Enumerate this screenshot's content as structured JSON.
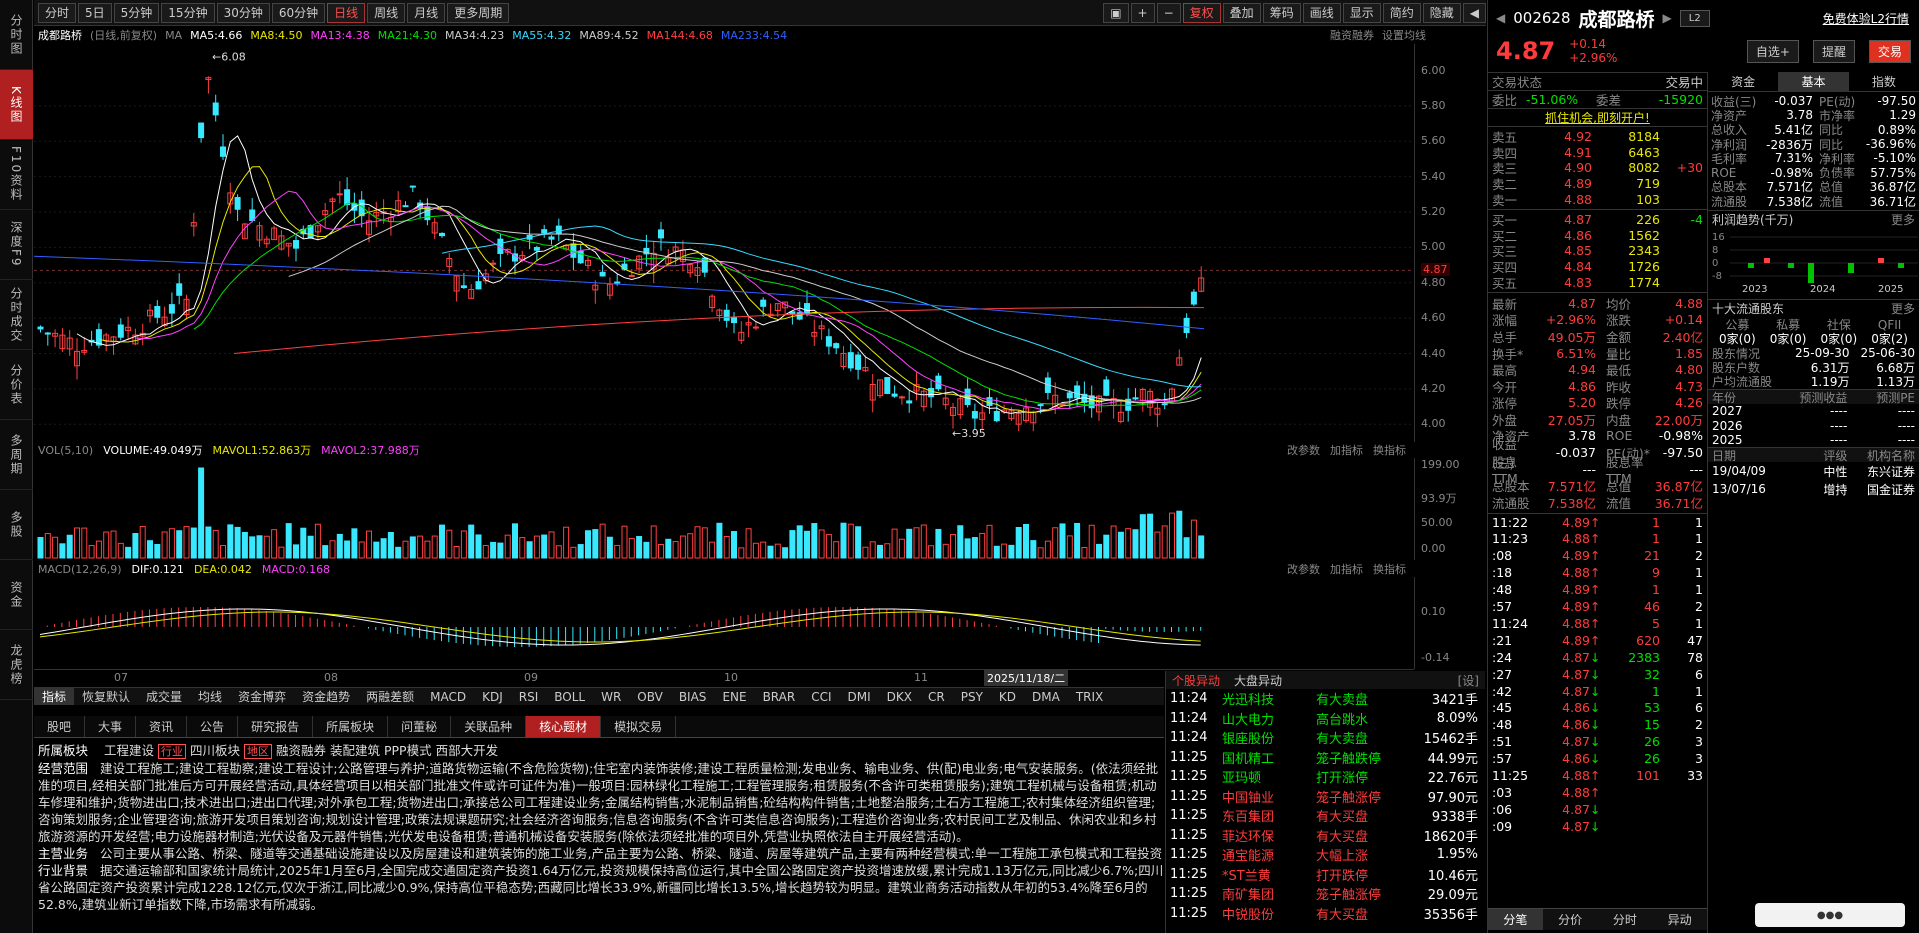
{
  "left_nav": [
    "分时图",
    "K线图",
    "F10资料",
    "深度F9",
    "分时成交",
    "分价表",
    "多周期",
    "多股",
    "资金",
    "龙虎榜"
  ],
  "toolbar": {
    "periods": [
      "分时",
      "5日",
      "5分钟",
      "15分钟",
      "30分钟",
      "60分钟",
      "日线",
      "周线",
      "月线",
      "更多周期"
    ],
    "active": "日线",
    "tools": [
      "复权",
      "叠加",
      "筹码",
      "画线",
      "显示",
      "简约",
      "隐藏"
    ]
  },
  "chart_head": {
    "name": "成都路桥",
    "mode": "(日线,前复权)",
    "ma_label": "MA",
    "ma": [
      {
        "t": "MA5:4.66",
        "c": "#ffffff"
      },
      {
        "t": "MA8:4.50",
        "c": "#e8e800"
      },
      {
        "t": "MA13:4.38",
        "c": "#ff40ff"
      },
      {
        "t": "MA21:4.30",
        "c": "#00e000"
      },
      {
        "t": "MA34:4.23",
        "c": "#cccccc"
      },
      {
        "t": "MA55:4.32",
        "c": "#38d8ff"
      },
      {
        "t": "MA89:4.52",
        "c": "#cccccc"
      },
      {
        "t": "MA144:4.68",
        "c": "#ff4040"
      },
      {
        "t": "MA233:4.54",
        "c": "#3060ff"
      }
    ],
    "right": [
      "融资融券",
      "设置均线"
    ]
  },
  "price_axis": [
    "6.00",
    "5.80",
    "5.60",
    "5.40",
    "5.20",
    "5.00",
    "4.87",
    "4.80",
    "4.60",
    "4.40",
    "4.20",
    "4.00"
  ],
  "annot": {
    "high": "6.08",
    "low": "3.95"
  },
  "vol_head": {
    "label": "VOL(5,10)",
    "volume": "VOLUME:49.049万",
    "mavol1": "MAVOL1:52.863万",
    "mavol2": "MAVOL2:37.988万",
    "tools": [
      "改参数",
      "加指标",
      "换指标"
    ]
  },
  "vol_axis": [
    "199.00",
    "93.9万",
    "50.00",
    "0.00"
  ],
  "macd_head": {
    "label": "MACD(12,26,9)",
    "dif": "DIF:0.121",
    "dea": "DEA:0.042",
    "macd": "MACD:0.168",
    "tools": [
      "改参数",
      "加指标",
      "换指标"
    ]
  },
  "macd_axis": [
    "0.10",
    "-0.14"
  ],
  "date_axis": [
    "07",
    "08",
    "09",
    "10",
    "11"
  ],
  "date_cursor": "2025/11/18/二",
  "indicator_tabs": [
    "指标",
    "恢复默认",
    "成交量",
    "均线",
    "资金博弈",
    "资金趋势",
    "两融差额",
    "MACD",
    "KDJ",
    "RSI",
    "BOLL",
    "WR",
    "OBV",
    "BIAS",
    "ENE",
    "BRAR",
    "CCI",
    "DMI",
    "DKX",
    "CR",
    "PSY",
    "KD",
    "DMA",
    "TRIX"
  ],
  "info_tabs": [
    "股吧",
    "大事",
    "资讯",
    "公告",
    "研究报告",
    "所属板块",
    "问董秘",
    "关联品种",
    "核心题材",
    "模拟交易"
  ],
  "info_active": "核心题材",
  "info": {
    "sector_label": "所属板块",
    "sectors": [
      "工程建设",
      "行业",
      "四川板块",
      "地区",
      "融资融券",
      "装配建筑",
      "PPP模式",
      "西部大开发"
    ],
    "scope_label": "经营范围",
    "scope": "建设工程施工;建设工程勘察;建设工程设计;公路管理与养护;道路货物运输(不含危险货物);住宅室内装饰装修;建设工程质量检测;发电业务、输电业务、供(配)电业务;电气安装服务。(依法须经批准的项目,经相关部门批准后方可开展经营活动,具体经营项目以相关部门批准文件或许可证件为准)一般项目:园林绿化工程施工;工程管理服务;租赁服务(不含许可类租赁服务);建筑工程机械与设备租赁;机动车修理和维护;货物进出口;技术进出口;进出口代理;对外承包工程;货物进出口;承接总公司工程建设业务;金属结构销售;水泥制品销售;砼结构构件销售;土地整治服务;土石方工程施工;农村集体经济组织管理;咨询策划服务;企业管理咨询;旅游开发项目策划咨询;规划设计管理;政策法规课题研究;社会经济咨询服务;信息咨询服务(不含许可类信息咨询服务);工程造价咨询业务;农村民间工艺及制品、休闲农业和乡村旅游资源的开发经营;电力设施器材制造;光伏设备及元器件销售;光伏发电设备租赁;普通机械设备安装服务(除依法须经批准的项目外,凭营业执照依法自主开展经营活动)。",
    "main_label": "主营业务",
    "main": "公司主要从事公路、桥梁、隧道等交通基础设施建设以及房屋建设和建筑装饰的施工业务,产品主要为公路、桥梁、隧道、房屋等建筑产品,主要有两种经营模式:单一工程施工承包模式和工程投资建设模式。",
    "bg_label": "行业背景",
    "bg": "据交通运输部和国家统计局统计,2025年1月至6月,全国完成交通固定资产投资1.64万亿元,投资规模保持高位运行,其中全国公路固定资产投资增速放缓,累计完成1.13万亿元,同比减少6.7%;四川省公路固定资产投资累计完成1228.12亿元,仅次于浙江,同比减少0.9%,保持高位平稳态势;西藏同比增长33.9%,新疆同比增长13.5%,增长趋势较为明显。建筑业商务活动指数从年初的53.4%降至6月的52.8%,建筑业新订单指数下降,市场需求有所减弱。"
  },
  "news": {
    "tabs": [
      "个股异动",
      "大盘异动",
      "[设]"
    ],
    "rows": [
      {
        "t": "11:24",
        "n": "光迅科技",
        "e": "有大卖盘",
        "v": "3421手",
        "c": "green"
      },
      {
        "t": "11:24",
        "n": "山大电力",
        "e": "高台跳水",
        "v": "8.09%",
        "c": "green"
      },
      {
        "t": "11:24",
        "n": "银座股份",
        "e": "有大卖盘",
        "v": "15462手",
        "c": "green"
      },
      {
        "t": "11:25",
        "n": "国机精工",
        "e": "笼子触跌停",
        "v": "44.99元",
        "c": "green"
      },
      {
        "t": "11:25",
        "n": "亚玛顿",
        "e": "打开涨停",
        "v": "22.76元",
        "c": "green"
      },
      {
        "t": "11:25",
        "n": "中国铀业",
        "e": "笼子触涨停",
        "v": "97.90元",
        "c": "red"
      },
      {
        "t": "11:25",
        "n": "东百集团",
        "e": "有大买盘",
        "v": "9338手",
        "c": "red"
      },
      {
        "t": "11:25",
        "n": "菲达环保",
        "e": "有大买盘",
        "v": "18620手",
        "c": "red"
      },
      {
        "t": "11:25",
        "n": "通宝能源",
        "e": "大幅上涨",
        "v": "1.95%",
        "c": "red"
      },
      {
        "t": "11:25",
        "n": "*ST兰黄",
        "e": "打开跌停",
        "v": "10.46元",
        "c": "red"
      },
      {
        "t": "11:25",
        "n": "南矿集团",
        "e": "笼子触涨停",
        "v": "29.09元",
        "c": "red"
      },
      {
        "t": "11:25",
        "n": "中锐股份",
        "e": "有大买盘",
        "v": "35356手",
        "c": "red"
      }
    ]
  },
  "rp": {
    "code": "002628",
    "name": "成都路桥",
    "level2": "免费体验L2行情",
    "price": "4.87",
    "chg": "+0.14",
    "pct": "+2.96%",
    "buttons": [
      "自选+",
      "提醒",
      "交易"
    ],
    "status": "交易状态",
    "status_val": "交易中",
    "webi": "委比",
    "webi_val": "-51.06%",
    "weicha": "委差",
    "weicha_val": "-15920",
    "ad": "抓住机会,即刻开户!",
    "sells": [
      [
        "卖五",
        "4.92",
        "8184",
        ""
      ],
      [
        "卖四",
        "4.91",
        "6463",
        ""
      ],
      [
        "卖三",
        "4.90",
        "8082",
        "+30"
      ],
      [
        "卖二",
        "4.89",
        "719",
        ""
      ],
      [
        "卖一",
        "4.88",
        "103",
        ""
      ]
    ],
    "buys": [
      [
        "买一",
        "4.87",
        "226",
        "-4"
      ],
      [
        "买二",
        "4.86",
        "1562",
        ""
      ],
      [
        "买三",
        "4.85",
        "2343",
        ""
      ],
      [
        "买四",
        "4.84",
        "1726",
        ""
      ],
      [
        "买五",
        "4.83",
        "1774",
        ""
      ]
    ],
    "quote": [
      [
        "最新",
        "4.87",
        "均价",
        "4.88"
      ],
      [
        "涨幅",
        "+2.96%",
        "涨跌",
        "+0.14"
      ],
      [
        "总手",
        "49.05万",
        "金额",
        "2.40亿"
      ],
      [
        "换手*",
        "6.51%",
        "量比",
        "1.85"
      ],
      [
        "最高",
        "4.94",
        "最低",
        "4.80"
      ],
      [
        "今开",
        "4.86",
        "昨收",
        "4.73"
      ],
      [
        "涨停",
        "5.20",
        "跌停",
        "4.26"
      ],
      [
        "外盘",
        "27.05万",
        "内盘",
        "22.00万"
      ],
      [
        "净资产",
        "3.78",
        "ROE",
        "-0.98%"
      ],
      [
        "收益(三)",
        "-0.037",
        "PE(动)*",
        "-97.50"
      ],
      [
        "股息TTM",
        "---",
        "股息率TTM",
        "---"
      ],
      [
        "总股本",
        "7.571亿",
        "总值",
        "36.87亿"
      ],
      [
        "流通股",
        "7.538亿",
        "流值",
        "36.71亿"
      ]
    ],
    "ticks": [
      [
        "11:22",
        "4.89",
        "1",
        "1"
      ],
      [
        "11:23",
        "4.88",
        "1",
        "1"
      ],
      [
        ":08",
        "4.89",
        "21",
        "2"
      ],
      [
        ":18",
        "4.88",
        "9",
        "1"
      ],
      [
        ":48",
        "4.89",
        "1",
        "1"
      ],
      [
        ":57",
        "4.89",
        "46",
        "2"
      ],
      [
        "11:24",
        "4.88",
        "5",
        "1"
      ],
      [
        ":21",
        "4.89",
        "620",
        "47"
      ],
      [
        ":24",
        "4.87",
        "2383",
        "78"
      ],
      [
        ":27",
        "4.87",
        "32",
        "6"
      ],
      [
        ":42",
        "4.87",
        "1",
        "1"
      ],
      [
        ":45",
        "4.86",
        "53",
        "6"
      ],
      [
        ":48",
        "4.86",
        "15",
        "2"
      ],
      [
        ":51",
        "4.87",
        "26",
        "3"
      ],
      [
        ":57",
        "4.86",
        "26",
        "3"
      ],
      [
        "11:25",
        "4.88",
        "101",
        "33"
      ],
      [
        ":03",
        "4.88",
        "",
        ""
      ],
      [
        ":06",
        "4.87",
        "",
        ""
      ],
      [
        ":09",
        "4.87",
        "",
        ""
      ]
    ],
    "tick_tabs": [
      "分笔",
      "分价",
      "分时",
      "异动"
    ],
    "ftabs": [
      "资金",
      "基本",
      "指数"
    ],
    "ftab_active": "基本",
    "fund": [
      [
        "收益(三)",
        "-0.037",
        "PE(动)",
        "-97.50"
      ],
      [
        "净资产",
        "3.78",
        "市净率",
        "1.29"
      ],
      [
        "总收入",
        "5.41亿",
        "同比",
        "0.89%"
      ],
      [
        "净利润",
        "-2836万",
        "同比",
        "-36.96%"
      ],
      [
        "毛利率",
        "7.31%",
        "净利率",
        "-5.10%"
      ],
      [
        "ROE",
        "-0.98%",
        "负债率",
        "57.75%"
      ],
      [
        "总股本",
        "7.571亿",
        "总值",
        "36.87亿"
      ],
      [
        "流通股",
        "7.538亿",
        "流值",
        "36.71亿"
      ]
    ],
    "profit_title": "利润趋势(千万)",
    "more": "更多",
    "profit_axis": [
      "16",
      "8",
      "0",
      "-8"
    ],
    "profit_years": [
      "2023",
      "2024",
      "2025"
    ],
    "holders_title": "十大流通股东",
    "holders_cols": [
      "公募",
      "私募",
      "社保",
      "QFII"
    ],
    "holders_vals": [
      "0家(0)",
      "0家(0)",
      "0家(0)",
      "0家(2)"
    ],
    "holders_rows": [
      [
        "股东情况",
        "25-09-30",
        "25-06-30"
      ],
      [
        "股东户数",
        "6.31万",
        "6.68万"
      ],
      [
        "户均流通股",
        "1.19万",
        "1.13万"
      ]
    ],
    "forecast_cols": [
      "年份",
      "预测收益",
      "预测PE"
    ],
    "forecast": [
      [
        "2027",
        "----",
        "----"
      ],
      [
        "2026",
        "----",
        "----"
      ],
      [
        "2025",
        "----",
        "----"
      ]
    ],
    "rating_cols": [
      "日期",
      "评级",
      "机构名称"
    ],
    "ratings": [
      [
        "19/04/09",
        "中性",
        "东兴证券"
      ],
      [
        "13/07/16",
        "增持",
        "国金证券"
      ]
    ]
  }
}
